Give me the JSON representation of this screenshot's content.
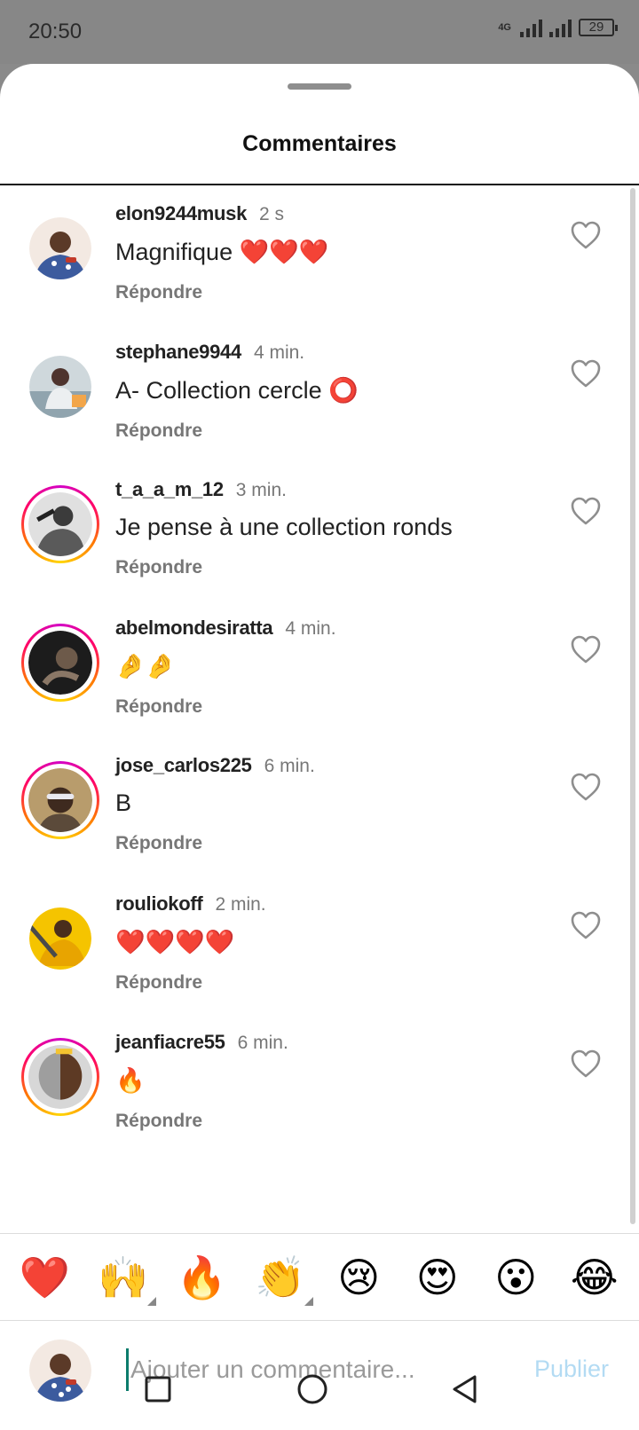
{
  "status_bar": {
    "time": "20:50",
    "network": "4G",
    "battery": "29"
  },
  "header": {
    "title": "Commentaires"
  },
  "comments": [
    {
      "username": "elon9244musk",
      "time": "2 s",
      "text": "Magnifique ❤️❤️❤️",
      "reply": "Répondre",
      "avatar_ring": false
    },
    {
      "username": "stephane9944",
      "time": "4 min.",
      "text": "A- Collection cercle ⭕",
      "reply": "Répondre",
      "avatar_ring": false
    },
    {
      "username": "t_a_a_m_12",
      "time": "3 min.",
      "text": "Je pense à une collection ronds",
      "reply": "Répondre",
      "avatar_ring": true
    },
    {
      "username": "abelmondesiratta",
      "time": "4 min.",
      "text": "🤌🤌",
      "reply": "Répondre",
      "avatar_ring": true
    },
    {
      "username": "jose_carlos225",
      "time": "6 min.",
      "text": "B",
      "reply": "Répondre",
      "avatar_ring": true
    },
    {
      "username": "rouliokoff",
      "time": "2 min.",
      "text": "❤️❤️❤️❤️",
      "reply": "Répondre",
      "avatar_ring": false
    },
    {
      "username": "jeanfiacre55",
      "time": "6 min.",
      "text": "🔥",
      "reply": "Répondre",
      "avatar_ring": true
    }
  ],
  "quick_reactions": [
    "❤️",
    "🙌",
    "🔥",
    "👏",
    "😢",
    "😍",
    "😮",
    "😂"
  ],
  "composer": {
    "placeholder": "Ajouter un commentaire...",
    "publish_label": "Publier"
  },
  "colors": {
    "publish_disabled": "#b3dbf3",
    "ring_gradient_start": "#d300c5",
    "ring_gradient_end": "#ffd600",
    "cursor": "#0c7c6c"
  }
}
